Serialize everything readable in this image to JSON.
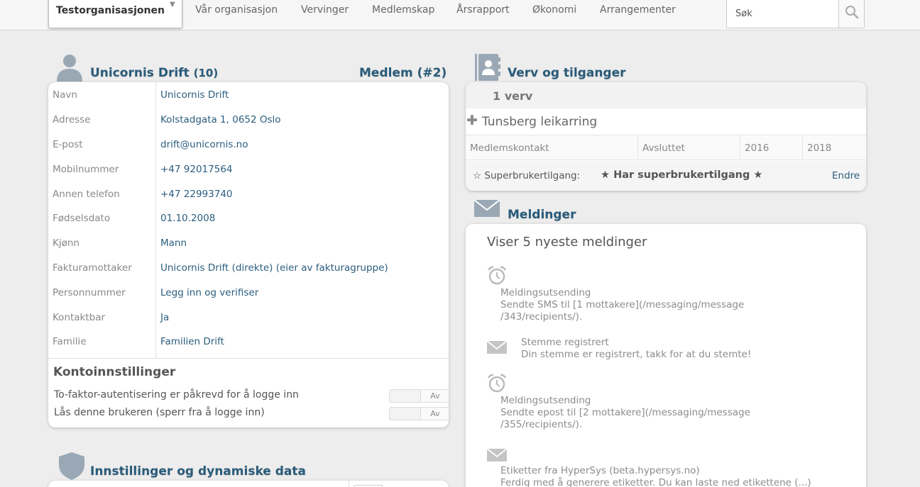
{
  "topbar": {
    "org_name": "Testorganisasjonen",
    "nav": [
      "Vår organisasjon",
      "Vervinger",
      "Medlemskap",
      "Årsrapport",
      "Økonomi",
      "Arrangementer"
    ],
    "search_placeholder": "Søk"
  },
  "member": {
    "title": "Unicornis Drift",
    "count": "(10)",
    "member_label": "Medlem (#2)",
    "fields": [
      {
        "label": "Navn",
        "value": "Unicornis Drift"
      },
      {
        "label": "Adresse",
        "value": "Kolstadgata 1, 0652 Oslo"
      },
      {
        "label": "E-post",
        "value": "drift@unicornis.no"
      },
      {
        "label": "Mobilnummer",
        "value": "+47 92017564"
      },
      {
        "label": "Annen telefon",
        "value": "+47 22993740"
      },
      {
        "label": "Fødselsdato",
        "value": "01.10.2008"
      },
      {
        "label": "Kjønn",
        "value": "Mann"
      },
      {
        "label": "Fakturamottaker",
        "value": "Unicornis Drift (direkte) (eier av fakturagruppe)"
      },
      {
        "label": "Personnummer",
        "value": "Legg inn og verifiser"
      },
      {
        "label": "Kontaktbar",
        "value": "Ja"
      },
      {
        "label": "Familie",
        "value": "Familien Drift"
      }
    ],
    "account": {
      "title": "Kontoinnstillinger",
      "settings": [
        {
          "label": "To-faktor-autentisering er påkrevd for å logge inn",
          "toggle": "Av"
        },
        {
          "label": "Lås denne brukeren (sperr fra å logge inn)",
          "toggle": "Av"
        }
      ]
    }
  },
  "verv": {
    "title": "Verv og tilganger",
    "count_label": "1 verv",
    "org_name": "Tunsberg leikarring",
    "row": [
      "Medlemskontakt",
      "Avsluttet",
      "2016",
      "2018"
    ],
    "superuser_label": "Superbrukertilgang:",
    "superuser_status": "Har superbrukertilgang",
    "edit_label": "Endre"
  },
  "messages": {
    "title": "Meldinger",
    "heading": "Viser 5 nyeste meldinger",
    "items": [
      {
        "icon": "alarm-clock-icon",
        "title": "Meldingsutsending",
        "line1": "Sendte SMS til [1 mottakere](/messaging/message",
        "line2": "/343/recipients/)."
      },
      {
        "icon": "envelope-icon",
        "title": "Stemme registrert",
        "line1": "Din stemme er registrert, takk for at du stemte!",
        "line2": ""
      },
      {
        "icon": "alarm-clock-icon",
        "title": "Meldingsutsending",
        "line1": "Sendte epost til [2 mottakere](/messaging/message",
        "line2": "/355/recipients/)."
      },
      {
        "icon": "envelope-icon",
        "title": "Etiketter fra HyperSys (beta.hypersys.no)",
        "line1": "Ferdig med å generere etiketter. Du kan laste ned etikettene (...)",
        "line2": ""
      }
    ]
  },
  "settings_section": {
    "title": "Innstillinger og dynamiske data"
  },
  "colors": {
    "heading_blue": "#2a5b7a",
    "link_blue": "#2b5d7e",
    "background": "#ededed"
  }
}
